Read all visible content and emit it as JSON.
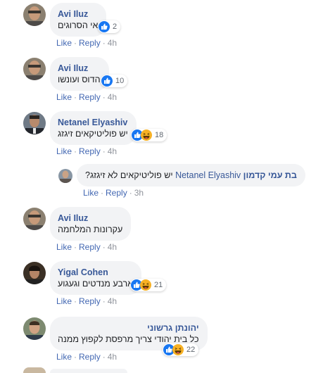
{
  "actions": {
    "like": "Like",
    "reply": "Reply",
    "dot": "·"
  },
  "comments": [
    {
      "author": "Avi Iluz",
      "text": "אי הסרוגים",
      "reactions": "2",
      "time": "4h"
    },
    {
      "author": "Avi Iluz",
      "text": "הדוס ועונשו",
      "reactions": "10",
      "time": "4h"
    },
    {
      "author": "Netanel Elyashiv",
      "text": "יש פוליטיקאים זיגזג",
      "reactions": "18",
      "time": "4h"
    },
    {
      "author": "בת עמי קדמון",
      "mention": "Netanel Elyashiv",
      "text": "יש פוליטיקאים לא זיגזג?",
      "time": "3h"
    },
    {
      "author": "Avi Iluz",
      "text": "עקרונות המלחמה",
      "time": "4h"
    },
    {
      "author": "Yigal Cohen",
      "text": "ארבע מנדטים וגעגוע",
      "reactions": "21",
      "time": "4h"
    },
    {
      "author": "יהונתן גרשוני",
      "text": "כל בית יהודי צריך מרפסת לקפוץ ממנה",
      "reactions": "22",
      "time": "4h"
    }
  ],
  "colors": {
    "link": "#385898",
    "action": "#4267b2",
    "like_blue": "#1877f2",
    "haha_yellow": "#f7b125",
    "bubble": "#f2f3f5"
  },
  "icons": {
    "like": "like-reaction-icon",
    "haha": "haha-reaction-icon"
  }
}
